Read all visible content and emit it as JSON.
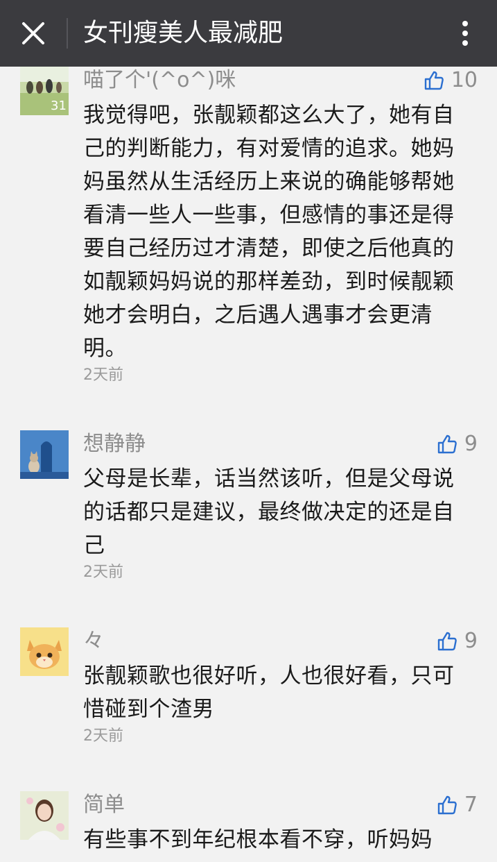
{
  "header": {
    "title": "女刊瘦美人最减肥"
  },
  "comments": [
    {
      "nickname": "喵了个'(^o^)咪",
      "likes": "10",
      "avatar_badge": "31",
      "content": "我觉得吧，张靓颖都这么大了，她有自己的判断能力，有对爱情的追求。她妈妈虽然从生活经历上来说的确能够帮她看清一些人一些事，但感情的事还是得要自己经历过才清楚，即使之后他真的如靓颖妈妈说的那样差劲，到时候靓颖她才会明白，之后遇人遇事才会更清明。",
      "time": "2天前"
    },
    {
      "nickname": "想静静",
      "likes": "9",
      "content": "父母是长辈，话当然该听，但是父母说的话都只是建议，最终做决定的还是自己",
      "time": "2天前"
    },
    {
      "nickname": "々",
      "likes": "9",
      "content": "张靓颖歌也很好听，人也很好看，只可惜碰到个渣男",
      "time": "2天前"
    },
    {
      "nickname": "简单",
      "likes": "7",
      "content": "有些事不到年纪根本看不穿，听妈妈",
      "time": ""
    }
  ],
  "icons": {
    "close": "close-icon",
    "more": "more-vertical-icon",
    "like": "thumbs-up-icon"
  },
  "colors": {
    "header_bg": "#3b3b3f",
    "page_bg": "#f2f2f2",
    "like_icon": "#2b6fd0",
    "secondary_text": "#8d8d8d"
  }
}
